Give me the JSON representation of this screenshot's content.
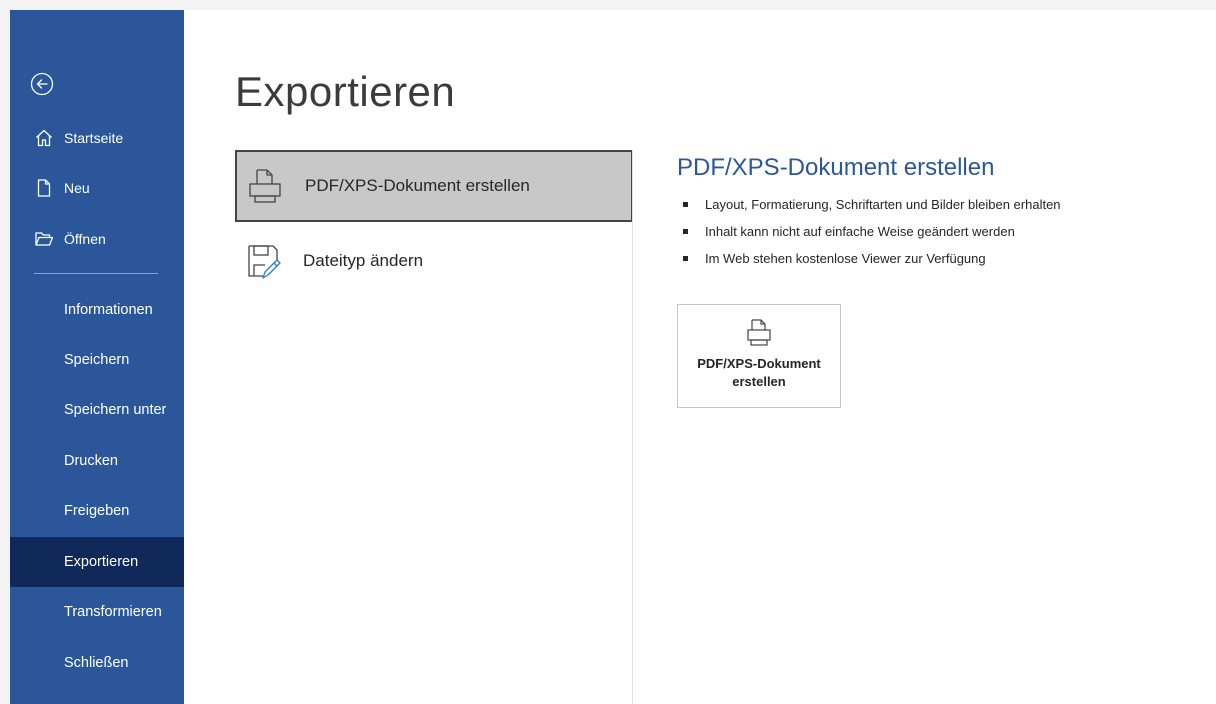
{
  "sidebar": {
    "back": {
      "icon": "back-arrow-icon"
    },
    "top_items": [
      {
        "label": "Startseite",
        "icon": "home-icon"
      },
      {
        "label": "Neu",
        "icon": "new-document-icon"
      },
      {
        "label": "Öffnen",
        "icon": "folder-open-icon"
      }
    ],
    "items": [
      {
        "label": "Informationen"
      },
      {
        "label": "Speichern"
      },
      {
        "label": "Speichern unter"
      },
      {
        "label": "Drucken"
      },
      {
        "label": "Freigeben"
      },
      {
        "label": "Exportieren",
        "active": true
      },
      {
        "label": "Transformieren"
      },
      {
        "label": "Schließen"
      }
    ]
  },
  "main": {
    "title": "Exportieren",
    "options": [
      {
        "label": "PDF/XPS-Dokument erstellen",
        "icon": "pdf-xps-document-icon",
        "selected": true
      },
      {
        "label": "Dateityp ändern",
        "icon": "change-file-type-icon",
        "selected": false
      }
    ],
    "detail": {
      "title": "PDF/XPS-Dokument erstellen",
      "bullets": [
        "Layout, Formatierung, Schriftarten und Bilder bleiben erhalten",
        "Inhalt kann nicht auf einfache Weise geändert werden",
        "Im Web stehen kostenlose Viewer zur Verfügung"
      ],
      "button": {
        "line1": "PDF/XPS-Dokument",
        "line2": "erstellen",
        "icon": "pdf-xps-document-icon"
      }
    }
  },
  "colors": {
    "sidebar_bg": "#2b579a",
    "sidebar_active": "#10295a",
    "accent_text": "#2b579a",
    "selected_option_bg": "#c8c8c8"
  }
}
